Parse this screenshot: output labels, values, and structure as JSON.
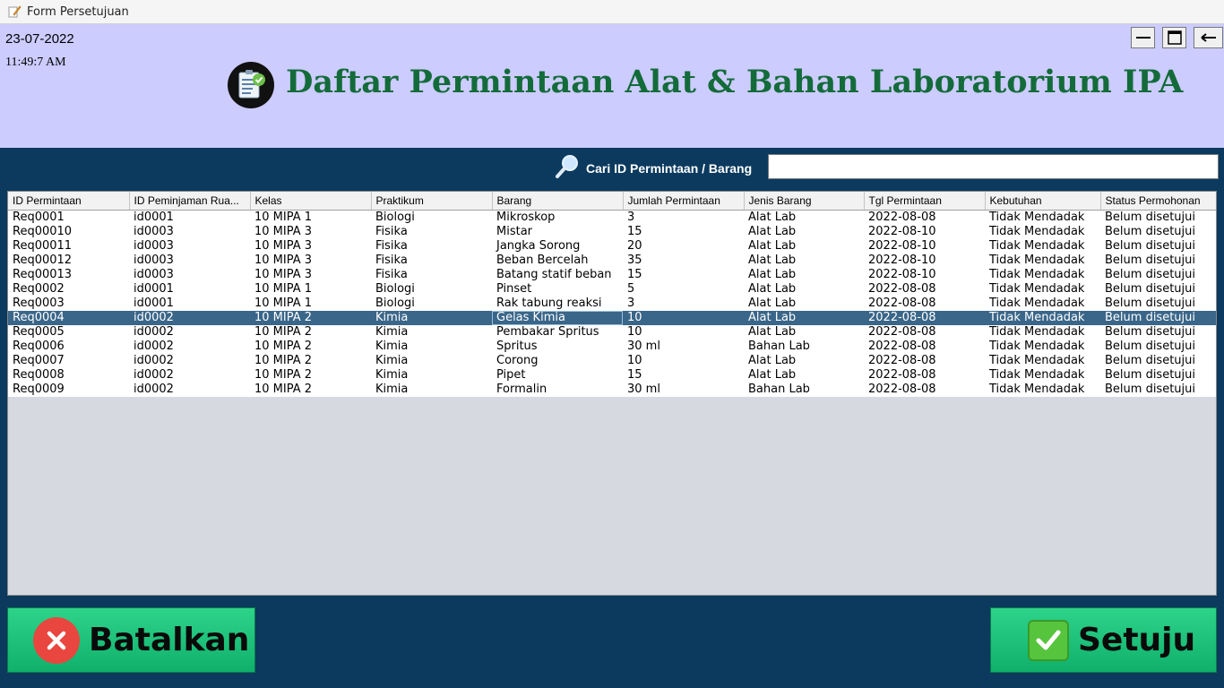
{
  "window": {
    "title": "Form Persetujuan"
  },
  "header": {
    "date": "23-07-2022",
    "time": "11:49:7 AM",
    "title": "Daftar Permintaan Alat & Bahan Laboratorium IPA"
  },
  "search": {
    "label": "Cari ID Permintaan / Barang",
    "value": ""
  },
  "table": {
    "columns": [
      "ID Permintaan",
      "ID Peminjaman Rua...",
      "Kelas",
      "Praktikum",
      "Barang",
      "Jumlah Permintaan",
      "Jenis Barang",
      "Tgl Permintaan",
      "Kebutuhan",
      "Status Permohonan"
    ],
    "selected_row": 7,
    "rows": [
      [
        "Req0001",
        "id0001",
        "10 MIPA 1",
        "Biologi",
        "Mikroskop",
        "3",
        "Alat Lab",
        "2022-08-08",
        "Tidak Mendadak",
        "Belum disetujui"
      ],
      [
        "Req00010",
        "id0003",
        "10 MIPA 3",
        "Fisika",
        "Mistar",
        "15",
        "Alat Lab",
        "2022-08-10",
        "Tidak Mendadak",
        "Belum disetujui"
      ],
      [
        "Req00011",
        "id0003",
        "10 MIPA 3",
        "Fisika",
        "Jangka Sorong",
        "20",
        "Alat Lab",
        "2022-08-10",
        "Tidak Mendadak",
        "Belum disetujui"
      ],
      [
        "Req00012",
        "id0003",
        "10 MIPA 3",
        "Fisika",
        "Beban Bercelah",
        "35",
        "Alat Lab",
        "2022-08-10",
        "Tidak Mendadak",
        "Belum disetujui"
      ],
      [
        "Req00013",
        "id0003",
        "10 MIPA 3",
        "Fisika",
        "Batang statif beban",
        "15",
        "Alat Lab",
        "2022-08-10",
        "Tidak Mendadak",
        "Belum disetujui"
      ],
      [
        "Req0002",
        "id0001",
        "10 MIPA 1",
        "Biologi",
        "Pinset",
        "5",
        "Alat Lab",
        "2022-08-08",
        "Tidak Mendadak",
        "Belum disetujui"
      ],
      [
        "Req0003",
        "id0001",
        "10 MIPA 1",
        "Biologi",
        "Rak tabung reaksi",
        "3",
        "Alat Lab",
        "2022-08-08",
        "Tidak Mendadak",
        "Belum disetujui"
      ],
      [
        "Req0004",
        "id0002",
        "10 MIPA 2",
        "Kimia",
        "Gelas Kimia",
        "10",
        "Alat Lab",
        "2022-08-08",
        "Tidak Mendadak",
        "Belum disetujui"
      ],
      [
        "Req0005",
        "id0002",
        "10 MIPA 2",
        "Kimia",
        "Pembakar Spritus",
        "10",
        "Alat Lab",
        "2022-08-08",
        "Tidak Mendadak",
        "Belum disetujui"
      ],
      [
        "Req0006",
        "id0002",
        "10 MIPA 2",
        "Kimia",
        "Spritus",
        "30 ml",
        "Bahan Lab",
        "2022-08-08",
        "Tidak Mendadak",
        "Belum disetujui"
      ],
      [
        "Req0007",
        "id0002",
        "10 MIPA 2",
        "Kimia",
        "Corong",
        "10",
        "Alat Lab",
        "2022-08-08",
        "Tidak Mendadak",
        "Belum disetujui"
      ],
      [
        "Req0008",
        "id0002",
        "10 MIPA 2",
        "Kimia",
        "Pipet",
        "15",
        "Alat Lab",
        "2022-08-08",
        "Tidak Mendadak",
        "Belum disetujui"
      ],
      [
        "Req0009",
        "id0002",
        "10 MIPA 2",
        "Kimia",
        "Formalin",
        "30 ml",
        "Bahan Lab",
        "2022-08-08",
        "Tidak Mendadak",
        "Belum disetujui"
      ]
    ]
  },
  "buttons": {
    "cancel_label": "Batalkan",
    "approve_label": "Setuju"
  },
  "colors": {
    "header_bg": "#ccccff",
    "body_bg": "#0b3a5e",
    "title_green": "#146b3a",
    "button_green": "#1dc47b",
    "selected_row": "#3a6689",
    "cancel_red": "#e9463f"
  },
  "icons": {
    "app": "pencil-icon",
    "logo": "clipboard-check-icon",
    "search": "magnifier-icon",
    "cancel": "x-circle-icon",
    "approve": "check-box-icon"
  }
}
